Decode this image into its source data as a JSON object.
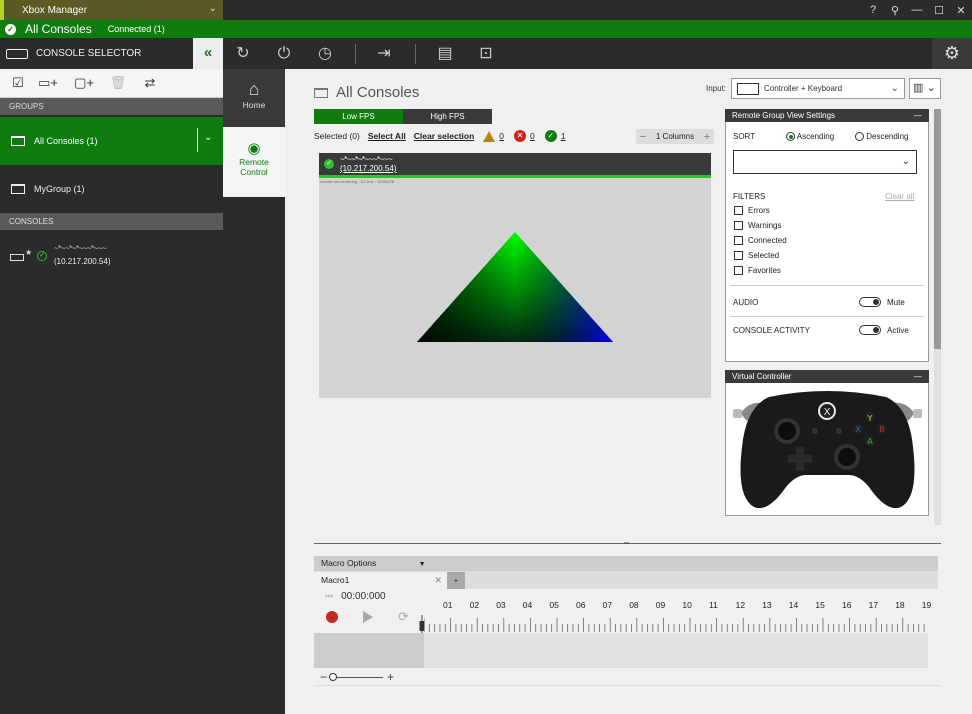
{
  "window": {
    "title": "Xbox Manager",
    "controls": [
      "?",
      "⚲",
      "—",
      "☐",
      "✕"
    ]
  },
  "status": {
    "group": "All Consoles",
    "connected": "Connected (1)"
  },
  "toolbar": {
    "console_selector_label": "CONSOLE SELECTOR"
  },
  "sidebar": {
    "groups_header": "GROUPS",
    "groups": [
      {
        "label": "All Consoles  (1)",
        "selected": true
      },
      {
        "label": "MyGroup  (1)",
        "selected": false
      }
    ],
    "consoles_header": "CONSOLES",
    "console": {
      "name": "~*~~*~*~~~*~~~",
      "ip": "(10.217.200.54)"
    }
  },
  "nav": {
    "home": "Home",
    "remote_line1": "Remote",
    "remote_line2": "Control"
  },
  "main": {
    "title": "All Consoles",
    "input_label": "Input:",
    "input_value": "Controller + Keyboard",
    "fps_low": "Low FPS",
    "fps_high": "High FPS",
    "selected_text": "Selected (0)",
    "select_all": "Select All",
    "clear_selection": "Clear selection",
    "warn_count": "0",
    "error_count": "0",
    "ok_count": "1",
    "columns": "1 Columns",
    "card": {
      "name": "~*~~*~*~~~*~~~",
      "ip": "(10.217.200.54)",
      "status_line": "remote ms  rendering - 14.1ms    ~  60X6478"
    }
  },
  "settings": {
    "title": "Remote Group View Settings",
    "sort_label": "SORT",
    "ascending": "Ascending",
    "descending": "Descending",
    "filters_label": "FILTERS",
    "clear_all": "Clear all",
    "filters": [
      "Errors",
      "Warnings",
      "Connected",
      "Selected",
      "Favorites"
    ],
    "audio_label": "AUDIO",
    "audio_state": "Mute",
    "activity_label": "CONSOLE ACTIVITY",
    "activity_state": "Active"
  },
  "virtual_controller": {
    "title": "Virtual Controller"
  },
  "macro": {
    "options": "Macro Options",
    "tab": "Macro1",
    "add": "+",
    "time": "00:00:000",
    "timeline": [
      "01",
      "02",
      "03",
      "04",
      "05",
      "06",
      "07",
      "08",
      "09",
      "10",
      "11",
      "12",
      "13",
      "14",
      "15",
      "16",
      "17",
      "18",
      "19"
    ]
  },
  "colors": {
    "accent": "#107c10",
    "dark": "#2b2b2b",
    "error": "#c42b1c",
    "warning": "#b8860b"
  }
}
